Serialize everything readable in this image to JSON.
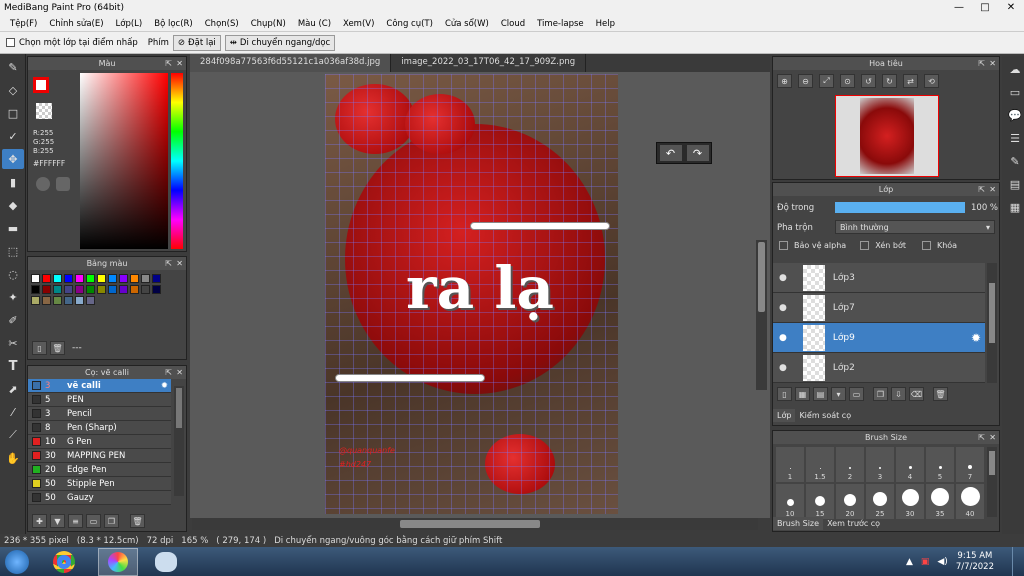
{
  "window": {
    "title": "MediBang Paint Pro (64bit)"
  },
  "menu": [
    "Tệp(F)",
    "Chỉnh sửa(E)",
    "Lớp(L)",
    "Bộ lọc(R)",
    "Chọn(S)",
    "Chụp(N)",
    "Màu (C)",
    "Xem(V)",
    "Công cụ(T)",
    "Cửa sổ(W)",
    "Cloud",
    "Time-lapse",
    "Help"
  ],
  "options": {
    "select_layer_label": "Chọn một lớp tại điểm nhấp",
    "key_label": "Phím",
    "reset_label": "Đặt lại",
    "move_label": "Di chuyển ngang/dọc"
  },
  "tabs": [
    "284f098a77563f6d55121c1a036af38d.jpg",
    "image_2022_03_17T06_42_17_909Z.png"
  ],
  "color_panel": {
    "title": "Màu",
    "r": "R:255",
    "g": "G:255",
    "b": "B:255",
    "hex": "#FFFFFF"
  },
  "palette_panel": {
    "title": "Bảng màu",
    "label": "---"
  },
  "brush_panel": {
    "title": "Cọ: vẽ calli",
    "items": [
      {
        "size": "3",
        "name": "vẽ calli",
        "color": "#3a6fa8"
      },
      {
        "size": "5",
        "name": "PEN",
        "color": "#333333"
      },
      {
        "size": "3",
        "name": "Pencil",
        "color": "#333333"
      },
      {
        "size": "8",
        "name": "Pen (Sharp)",
        "color": "#333333"
      },
      {
        "size": "10",
        "name": "G Pen",
        "color": "#e02020"
      },
      {
        "size": "30",
        "name": "MAPPING PEN",
        "color": "#e02020"
      },
      {
        "size": "20",
        "name": "Edge Pen",
        "color": "#20b020"
      },
      {
        "size": "50",
        "name": "Stipple Pen",
        "color": "#e0d020"
      },
      {
        "size": "50",
        "name": "Gauzy",
        "color": "#333333"
      }
    ]
  },
  "navigator": {
    "title": "Hoa tiêu"
  },
  "layer_panel": {
    "title": "Lớp",
    "opacity_label": "Độ trong",
    "opacity_value": "100 %",
    "opacity": 1.0,
    "blend_label": "Pha trộn",
    "blend_value": "Bình thường",
    "protect_alpha": "Bảo vệ alpha",
    "clipping": "Xén bớt",
    "lock": "Khóa",
    "layers": [
      "Lớp3",
      "Lớp7",
      "Lớp9",
      "Lớp2"
    ],
    "tab1": "Lớp",
    "tab2": "Kiểm soát cọ"
  },
  "brush_size": {
    "title": "Brush Size",
    "sizes_row1": [
      "1",
      "1.5",
      "2",
      "3",
      "4",
      "5",
      "7"
    ],
    "sizes_row2": [
      "10",
      "15",
      "20",
      "25",
      "30",
      "35",
      "40"
    ],
    "tab1": "Brush Size",
    "tab2": "Xem trước cọ"
  },
  "canvas": {
    "text_main": "ra lạ",
    "text_handle": "@quanquanfe",
    "text_tag": "#hd247"
  },
  "status": {
    "size": "236 * 355 pixel",
    "cm": "(8.3 * 12.5cm)",
    "dpi": "72 dpi",
    "zoom": "165 %",
    "coords": "( 279, 174 )",
    "hint": "Di chuyển ngang/vuông góc bằng cách giữ phím Shift"
  },
  "taskbar": {
    "time": "9:15 AM",
    "date": "7/7/2022"
  }
}
